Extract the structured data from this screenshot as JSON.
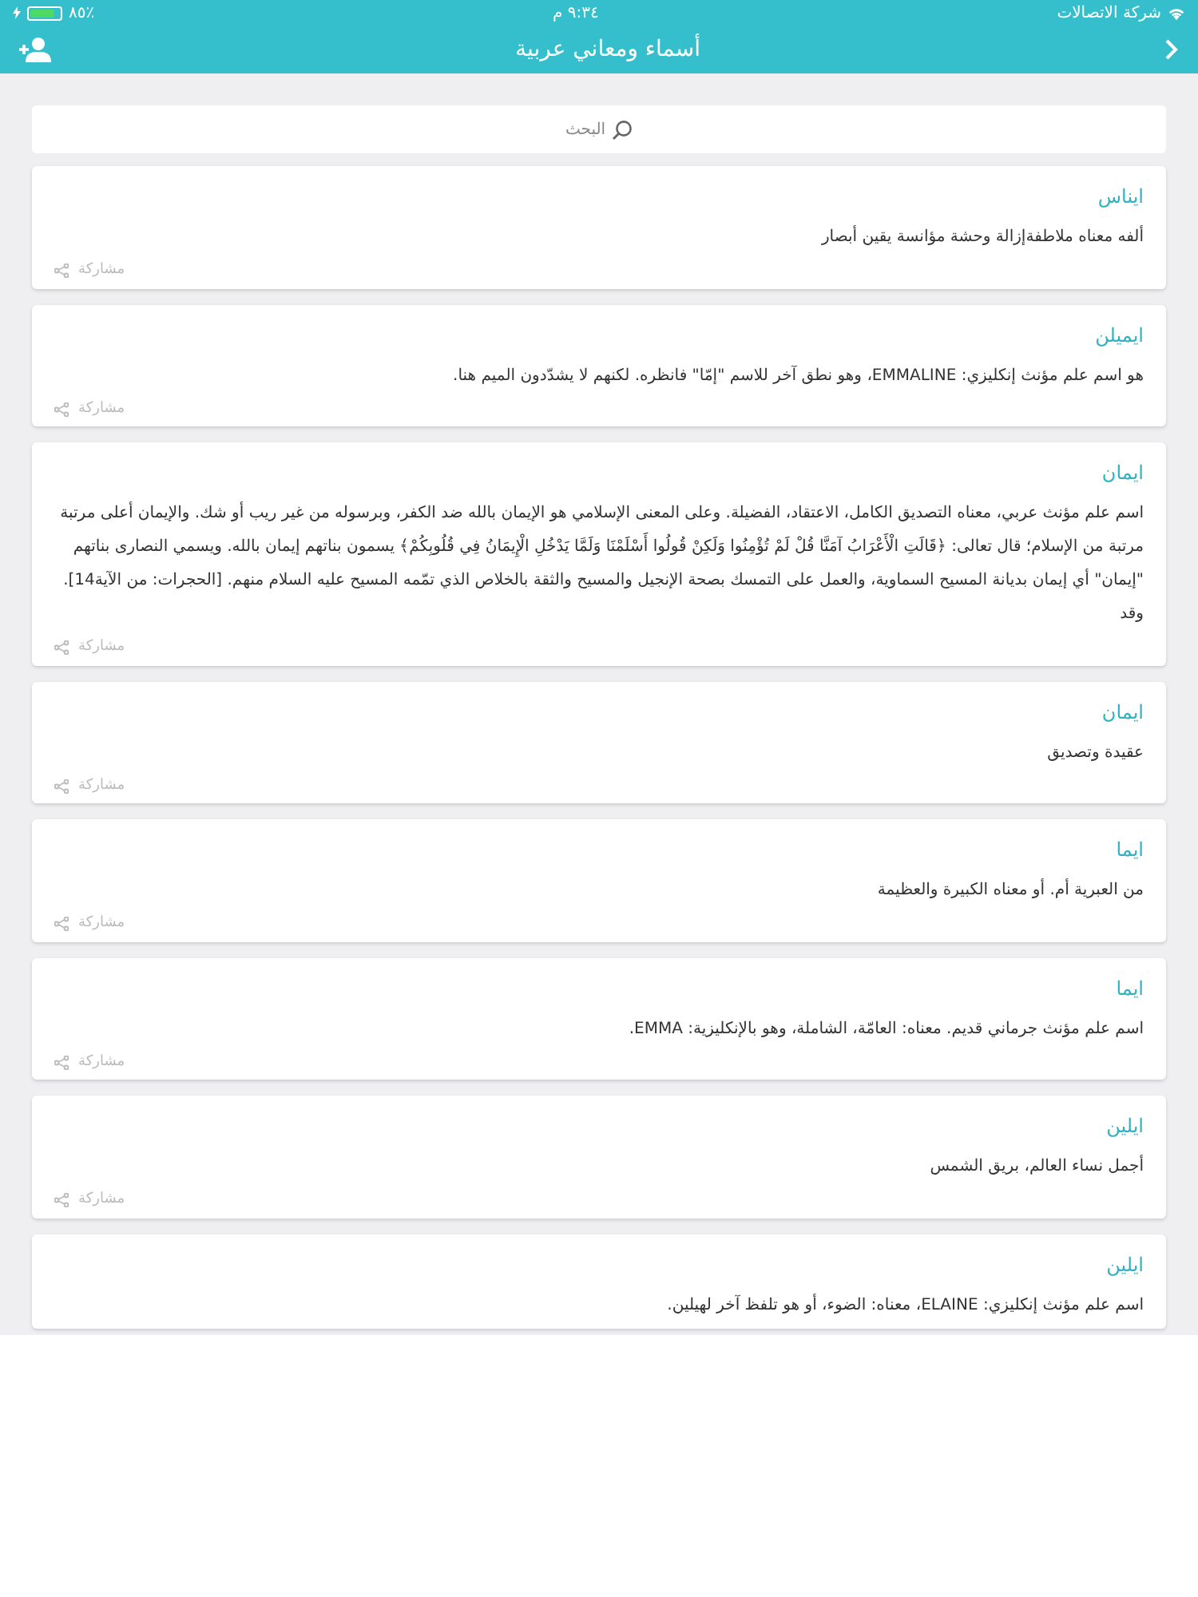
{
  "status_bar": {
    "carrier": "شركة الاتصالات",
    "time": "٩:٣٤ م",
    "battery": "٪٨٥"
  },
  "nav": {
    "title": "أسماء ومعاني عربية"
  },
  "search": {
    "placeholder": "البحث"
  },
  "cards": [
    {
      "name": "ايناس",
      "meaning": "ألفه معناه ملاطفةإزالة وحشة مؤانسة يقين أبصار",
      "share": "مشاركة"
    },
    {
      "name": "ايميلن",
      "meaning": "هو اسم علم مؤنث إنكليزي: EMMALINE، وهو نطق آخر للاسم \"إمّا\" فانظره. لكنهم لا يشدّدون الميم هنا.",
      "share": "مشاركة"
    },
    {
      "name": "ايمان",
      "meaning": "اسم علم مؤنث عربي، معناه التصديق الكامل، الاعتقاد، الفضيلة. وعلى المعنى الإسلامي هو الإيمان بالله ضد الكفر، وبرسوله من غير ريب أو شك. والإيمان أعلى مرتبة مرتبة من الإسلام؛ قال تعالى: ﴿قَالَتِ الْأَعْرَابُ آمَنَّا قُلْ لَمْ تُؤْمِنُوا وَلَكِنْ قُولُوا أَسْلَمْنَا وَلَمَّا يَدْخُلِ الْإِيمَانُ فِي قُلُوبِكُمْ﴾ يسمون بناتهم إيمان بالله. ويسمي النصارى بناتهم \"إيمان\" أي إيمان بديانة المسيح السماوية، والعمل على التمسك بصحة الإنجيل والمسيح والثقة بالخلاص الذي تمّمه المسيح عليه السلام منهم. [الحجرات: من الآية14]. وقد",
      "share": "مشاركة"
    },
    {
      "name": "ايمان",
      "meaning": "عقيدة وتصديق",
      "share": "مشاركة"
    },
    {
      "name": "ايما",
      "meaning": "من العبرية أم. أو معناه الكبيرة والعظيمة",
      "share": "مشاركة"
    },
    {
      "name": "ايما",
      "meaning": "اسم علم مؤنث جرماني قديم. معناه: العامّة، الشاملة، وهو بالإنكليزية: EMMA.",
      "share": "مشاركة"
    },
    {
      "name": "ايلين",
      "meaning": "أجمل نساء العالم، بريق الشمس",
      "share": "مشاركة"
    },
    {
      "name": "ايلين",
      "meaning": "اسم علم مؤنث إنكليزي: ELAINE، معناه: الضوء، أو هو تلفظ آخر لهيلين."
    }
  ]
}
